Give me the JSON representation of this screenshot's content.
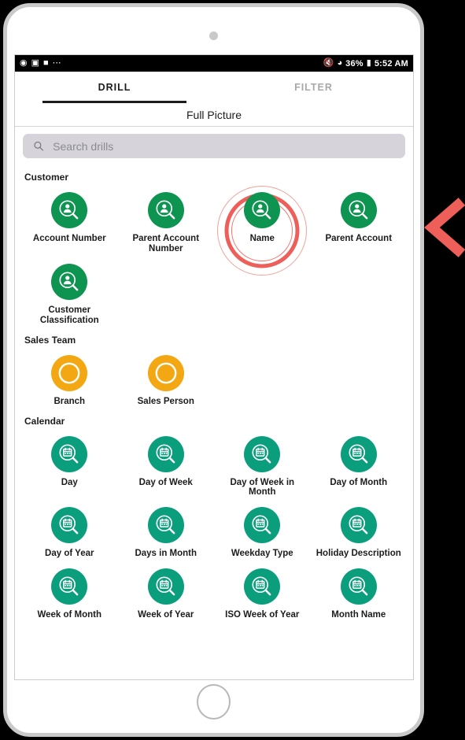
{
  "device": {
    "type": "tablet-frame",
    "camera": "camera-dot",
    "home_button": "home-button"
  },
  "status_bar": {
    "left_icons": [
      "alarm-icon",
      "image-icon",
      "bag-icon",
      "more-icon"
    ],
    "left_glyphs": [
      "◎",
      "Ὓc",
      "▮",
      "···"
    ],
    "right_icons": [
      "mute-icon",
      "wifi-icon",
      "battery-icon"
    ],
    "battery": "36%",
    "time": "5:52 AM"
  },
  "tabs": [
    {
      "label": "DRILL",
      "active": true
    },
    {
      "label": "FILTER",
      "active": false
    }
  ],
  "sub_header": {
    "title": "Full Picture"
  },
  "search": {
    "placeholder": "Search drills",
    "value": "",
    "icon": "search-icon"
  },
  "colors": {
    "customer_icon": "#0e9451",
    "sales_icon": "#f3a712",
    "calendar_icon": "#0a9e7d",
    "highlight_ring": "#ed5f5a",
    "highlight_ring_light": "#f2a19b",
    "marker_chevron": "#ef5f5a",
    "search_bg": "#d6d4da",
    "tab_active": "#1c1c1c",
    "tab_inactive": "#a8a8a8"
  },
  "sections": [
    {
      "title": "Customer",
      "icon_kind": "person-search",
      "color": "#0e9451",
      "items": [
        {
          "label": "Account Number",
          "highlighted": false
        },
        {
          "label": "Parent Account Number",
          "highlighted": false
        },
        {
          "label": "Name",
          "highlighted": true
        },
        {
          "label": "Parent Account",
          "highlighted": false
        },
        {
          "label": "Customer Classification",
          "highlighted": false
        }
      ]
    },
    {
      "title": "Sales Team",
      "icon_kind": "ring",
      "color": "#f3a712",
      "items": [
        {
          "label": "Branch",
          "highlighted": false
        },
        {
          "label": "Sales Person",
          "highlighted": false
        }
      ]
    },
    {
      "title": "Calendar",
      "icon_kind": "calendar-search",
      "color": "#0a9e7d",
      "items": [
        {
          "label": "Day",
          "highlighted": false
        },
        {
          "label": "Day of Week",
          "highlighted": false
        },
        {
          "label": "Day of Week in Month",
          "highlighted": false
        },
        {
          "label": "Day of Month",
          "highlighted": false
        },
        {
          "label": "Day of Year",
          "highlighted": false
        },
        {
          "label": "Days in Month",
          "highlighted": false
        },
        {
          "label": "Weekday Type",
          "highlighted": false
        },
        {
          "label": "Holiday Description",
          "highlighted": false
        },
        {
          "label": "Week of Month",
          "highlighted": false
        },
        {
          "label": "Week of Year",
          "highlighted": false
        },
        {
          "label": "ISO Week of Year",
          "highlighted": false
        },
        {
          "label": "Month Name",
          "highlighted": false
        }
      ]
    }
  ],
  "marker": {
    "name": "chevron-left-marker",
    "direction": "left"
  }
}
